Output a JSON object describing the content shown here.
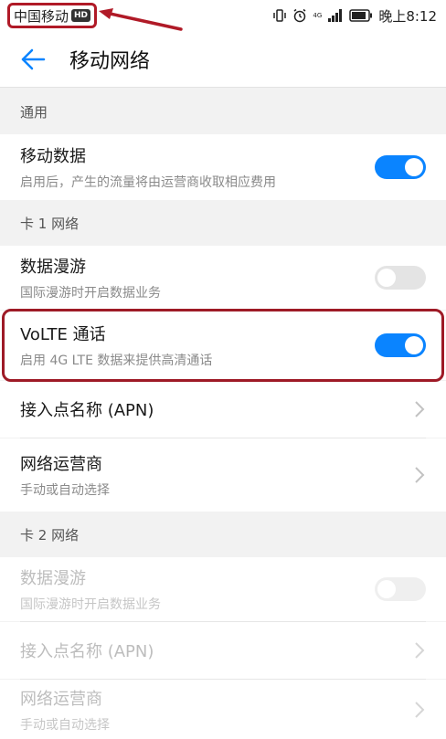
{
  "status_bar": {
    "carrier": "中国移动",
    "hd_badge": "HD",
    "network_label": "4G",
    "time": "晚上8:12",
    "icons": [
      "vibrate-icon",
      "alarm-icon",
      "signal-icon",
      "battery-icon"
    ]
  },
  "app_bar": {
    "title": "移动网络",
    "back_icon": "back-arrow-icon"
  },
  "sections": {
    "general": {
      "header": "通用",
      "mobile_data": {
        "title": "移动数据",
        "subtitle": "启用后，产生的流量将由运营商收取相应费用",
        "toggle": "on"
      }
    },
    "sim1": {
      "header": "卡 1 网络",
      "data_roaming": {
        "title": "数据漫游",
        "subtitle": "国际漫游时开启数据业务",
        "toggle": "off"
      },
      "volte": {
        "title": "VoLTE 通话",
        "subtitle": "启用 4G LTE 数据来提供高清通话",
        "toggle": "on"
      },
      "apn": {
        "title": "接入点名称 (APN)"
      },
      "carrier": {
        "title": "网络运营商",
        "subtitle": "手动或自动选择"
      }
    },
    "sim2": {
      "header": "卡 2 网络",
      "data_roaming": {
        "title": "数据漫游",
        "subtitle": "国际漫游时开启数据业务",
        "toggle": "off"
      },
      "apn": {
        "title": "接入点名称 (APN)"
      },
      "carrier": {
        "title": "网络运营商",
        "subtitle": "手动或自动选择"
      }
    }
  },
  "colors": {
    "accent": "#0a84ff",
    "annotation": "#b01a27"
  }
}
